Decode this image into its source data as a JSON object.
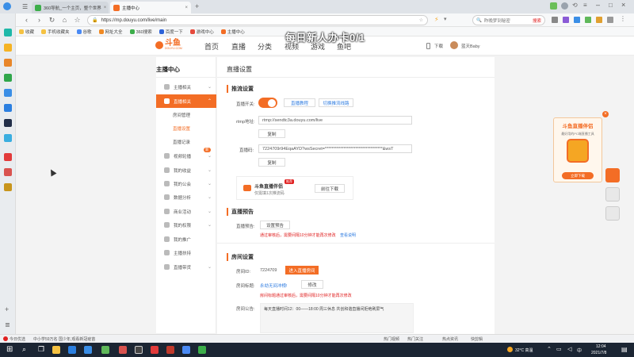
{
  "browser": {
    "tabs": [
      {
        "label": "360导航_一个主页，整个世界",
        "active": false
      },
      {
        "label": "主播中心",
        "active": true
      }
    ],
    "url": "https://mp.douyu.com/live/main",
    "search_placeholder": "昨晚梦到秘密",
    "search_engine_label": "搜索",
    "bookmarks": [
      "收藏",
      "手机收藏夹",
      "谷歌",
      "网址大全",
      "360搜索",
      "百度一下",
      "游戏中心",
      "主播中心"
    ]
  },
  "overlay_text": "每日新人办卡0/1",
  "douyu": {
    "logo_text": "斗鱼",
    "logo_sub": "DOUYU.COM",
    "nav": [
      "首页",
      "直播",
      "分类",
      "视频",
      "游戏",
      "鱼吧"
    ],
    "header_right": {
      "download": "下载",
      "username": "蓝天Baby"
    }
  },
  "sidebar": {
    "title": "主播中心",
    "items": [
      {
        "label": "主播相关",
        "type": "group"
      },
      {
        "label": "直播相关",
        "type": "group-active"
      },
      {
        "label": "房间管理",
        "type": "sub"
      },
      {
        "label": "直播设置",
        "type": "sub-selected"
      },
      {
        "label": "直播记录",
        "type": "sub"
      },
      {
        "label": "视频轮播",
        "type": "group",
        "badge": "新"
      },
      {
        "label": "我的收益",
        "type": "group"
      },
      {
        "label": "我的公会",
        "type": "group"
      },
      {
        "label": "数据分析",
        "type": "group"
      },
      {
        "label": "商业活动",
        "type": "group"
      },
      {
        "label": "我的权限",
        "type": "group"
      },
      {
        "label": "我的推广",
        "type": "group"
      },
      {
        "label": "主播扶持",
        "type": "group"
      },
      {
        "label": "直播带货",
        "type": "group"
      }
    ]
  },
  "main": {
    "page_title": "直播设置",
    "stream": {
      "title": "推流设置",
      "switch_label": "直播开关:",
      "switch_on": true,
      "tutorial_link": "直播教程",
      "switch_line_link": "切换推流线路",
      "rtmp_label": "rtmp地址:",
      "rtmp_value": "rtmp://sendtc3a.douyu.com/live",
      "copy1": "复制",
      "code_label": "直播码:",
      "code_value": "7224709r94EqaAYD?wsSecret=**********************************&wsT",
      "copy2": "复制",
      "companion_name": "斗鱼直播伴侣",
      "companion_desc": "仅需填1次推流码",
      "companion_tag": "推荐",
      "companion_btn": "前往下载"
    },
    "preview": {
      "title": "直播预告",
      "label": "直播预告:",
      "button": "设置预告",
      "warning": "通过审核后，需要间隔10分钟才能再次修改",
      "link": "查看说明"
    },
    "room": {
      "title": "房间设置",
      "id_label": "房间ID:",
      "id_value": "7224709",
      "enter_button": "进入直播房间",
      "name_label": "房间标题:",
      "name_value": "永劫无间冲榜!",
      "edit_button": "修改",
      "warning": "房间标题通过审核后，需要间隔10分钟才能再次修改",
      "notice_label": "房间公告:",
      "notice_value": "每天直播时间12：00——18:00 周三休息 共创和谐直播间拒绝刷屏气"
    }
  },
  "right_ad": {
    "title": "斗鱼直播伴侣",
    "desc": "最好用的PC端直播工具",
    "button": "立即下载"
  },
  "status_bar": {
    "left": "今日优选",
    "news": "中小学59万名 国少年,观看新冠疫苗",
    "items": [
      "热门视频",
      "热门关注",
      "热点资讯",
      "快剪辑"
    ]
  },
  "taskbar": {
    "weather": "32°C 高温",
    "lang": "中",
    "time": "12:04",
    "date": "2021/7/8"
  },
  "colors": {
    "accent": "#f36d25",
    "link": "#2d7be0",
    "warning": "#e02020"
  }
}
